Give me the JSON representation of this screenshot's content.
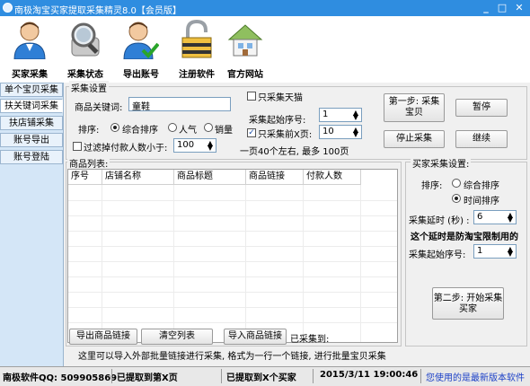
{
  "window": {
    "title": "南极淘宝买家提取采集精灵8.0【会员版】",
    "minimize": "_",
    "close": "✕",
    "maximize": "□"
  },
  "toolbar": [
    {
      "label": "买家采集",
      "icon": "user-icon"
    },
    {
      "label": "采集状态",
      "icon": "magnifier-icon"
    },
    {
      "label": "导出账号",
      "icon": "user-check-icon"
    },
    {
      "label": "注册软件",
      "icon": "padlock-icon"
    },
    {
      "label": "官方网站",
      "icon": "house-icon"
    }
  ],
  "sidebar": {
    "items": [
      {
        "label": "单个宝贝采集",
        "active": false
      },
      {
        "label": "扶关键词采集",
        "active": true
      },
      {
        "label": "扶店铺采集",
        "active": false
      },
      {
        "label": "账号导出",
        "active": false
      },
      {
        "label": "账号登陆",
        "active": false
      }
    ]
  },
  "settings": {
    "legend": "采集设置",
    "keyword_label": "商品关键词:",
    "keyword_value": "童鞋",
    "sort_label": "排序:",
    "sort_options": [
      "综合排序",
      "人气",
      "销量"
    ],
    "sort_selected": 0,
    "filter_checkbox_label": "过滤掉付款人数小于:",
    "filter_checked": false,
    "filter_value": "100",
    "only_tmall_label": "只采集天猫",
    "only_tmall_checked": false,
    "start_page_label": "采集起始序号:",
    "start_page_value": "1",
    "first_pages_label": "只采集前X页:",
    "first_pages_checked": true,
    "first_pages_value": "10",
    "per_page_note": "一页40个左右, 最多 100页",
    "step1_button": "第一步: 采集宝贝",
    "pause_button": "暂停",
    "stop_button": "停止采集",
    "continue_button": "继续"
  },
  "product_list": {
    "legend": "商品列表:",
    "columns": [
      "序号",
      "店铺名称",
      "商品标题",
      "商品链接",
      "付款人数"
    ]
  },
  "buyer_settings": {
    "legend": "买家采集设置:",
    "sort_label": "排序:",
    "sort_options": [
      "综合排序",
      "时间排序"
    ],
    "sort_selected": 1,
    "delay_label": "采集延时 (秒) :",
    "delay_value": "6",
    "warning": "这个延时是防淘宝限制用的",
    "start_label": "采集起始序号:",
    "start_value": "1",
    "step2_button": "第二步: 开始采集买家"
  },
  "bottom": {
    "export_button": "导出商品链接",
    "clear_button": "清空列表",
    "import_button": "导入商品链接",
    "collected_label": "已采集到:",
    "hint": "这里可以导入外部批量链接进行采集, 格式为一行一个链接, 进行批量宝贝采集"
  },
  "statusbar": {
    "qq": "南极软件QQ: 509905869",
    "got_pages": "已提取到第X页",
    "got_buyers": "已提取到X个买家",
    "datetime": "2015/3/11 19:00:46",
    "version_note": "您使用的是最新版本软件"
  },
  "colors": {
    "title_bg": "#2f8de0",
    "panel_bg": "#f0f0f0",
    "status_link": "#1a3fc7",
    "warning_text": "#000000"
  }
}
